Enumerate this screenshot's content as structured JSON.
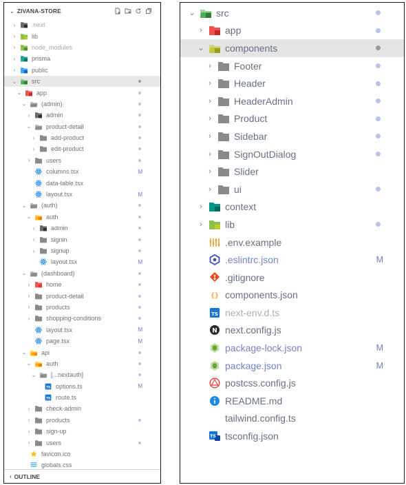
{
  "left": {
    "title": "ZIVANA-STORE",
    "outline_label": "OUTLINE",
    "rows": [
      {
        "label": ".next",
        "depth": 0,
        "chev": "right",
        "icon": "folder-next",
        "dim": true
      },
      {
        "label": "lib",
        "depth": 0,
        "chev": "right",
        "icon": "folder-lib"
      },
      {
        "label": "node_modules",
        "depth": 0,
        "chev": "right",
        "icon": "folder-node",
        "dim": true
      },
      {
        "label": "prisma",
        "depth": 0,
        "chev": "right",
        "icon": "folder-prisma"
      },
      {
        "label": "public",
        "depth": 0,
        "chev": "right",
        "icon": "folder-public"
      },
      {
        "label": "src",
        "depth": 0,
        "chev": "down",
        "icon": "folder-src",
        "dot": true,
        "selected": true
      },
      {
        "label": "app",
        "depth": 1,
        "chev": "down",
        "icon": "folder-app",
        "dot": true
      },
      {
        "label": "(admin)",
        "depth": 2,
        "chev": "down",
        "icon": "folder-gray-open",
        "dot": true
      },
      {
        "label": "admin",
        "depth": 3,
        "chev": "right",
        "icon": "folder-admin",
        "dot": true
      },
      {
        "label": "product-detail",
        "depth": 3,
        "chev": "down",
        "icon": "folder-gray-open",
        "dot": true
      },
      {
        "label": "add-product",
        "depth": 4,
        "chev": "right",
        "icon": "folder-gray",
        "dot": true
      },
      {
        "label": "edit-product",
        "depth": 4,
        "chev": "right",
        "icon": "folder-gray",
        "dot": true
      },
      {
        "label": "users",
        "depth": 3,
        "chev": "right",
        "icon": "folder-gray",
        "dot": true
      },
      {
        "label": "columns.tsx",
        "depth": 3,
        "chev": "none",
        "icon": "react",
        "status": "M"
      },
      {
        "label": "data-table.tsx",
        "depth": 3,
        "chev": "none",
        "icon": "react"
      },
      {
        "label": "layout.tsx",
        "depth": 3,
        "chev": "none",
        "icon": "react",
        "status": "M"
      },
      {
        "label": "(auth)",
        "depth": 2,
        "chev": "down",
        "icon": "folder-gray-open",
        "dot": true
      },
      {
        "label": "auth",
        "depth": 3,
        "chev": "down",
        "icon": "folder-auth",
        "dot": true
      },
      {
        "label": "admin",
        "depth": 4,
        "chev": "right",
        "icon": "folder-admin",
        "dot": true
      },
      {
        "label": "signin",
        "depth": 4,
        "chev": "right",
        "icon": "folder-gray",
        "dot": true
      },
      {
        "label": "signup",
        "depth": 4,
        "chev": "right",
        "icon": "folder-gray",
        "dot": true
      },
      {
        "label": "layout.tsx",
        "depth": 4,
        "chev": "none",
        "icon": "react",
        "status": "M"
      },
      {
        "label": "(dashboard)",
        "depth": 2,
        "chev": "down",
        "icon": "folder-gray-open",
        "dot": true
      },
      {
        "label": "home",
        "depth": 3,
        "chev": "right",
        "icon": "folder-home",
        "dot": true
      },
      {
        "label": "product-detail",
        "depth": 3,
        "chev": "right",
        "icon": "folder-gray",
        "dot": true
      },
      {
        "label": "products",
        "depth": 3,
        "chev": "right",
        "icon": "folder-gray",
        "dot": true
      },
      {
        "label": "shopping-conditions",
        "depth": 3,
        "chev": "right",
        "icon": "folder-gray",
        "dot": true
      },
      {
        "label": "layout.tsx",
        "depth": 3,
        "chev": "none",
        "icon": "react",
        "status": "M"
      },
      {
        "label": "page.tsx",
        "depth": 3,
        "chev": "none",
        "icon": "react",
        "status": "M"
      },
      {
        "label": "api",
        "depth": 2,
        "chev": "down",
        "icon": "folder-api",
        "dot": true
      },
      {
        "label": "auth",
        "depth": 3,
        "chev": "down",
        "icon": "folder-auth",
        "dot": true
      },
      {
        "label": "[...nextauth]",
        "depth": 4,
        "chev": "down",
        "icon": "folder-gray-open",
        "dot": true
      },
      {
        "label": "options.ts",
        "depth": 5,
        "chev": "none",
        "icon": "ts",
        "status": "M"
      },
      {
        "label": "route.ts",
        "depth": 5,
        "chev": "none",
        "icon": "ts"
      },
      {
        "label": "check-admin",
        "depth": 3,
        "chev": "right",
        "icon": "folder-gray"
      },
      {
        "label": "products",
        "depth": 3,
        "chev": "right",
        "icon": "folder-gray",
        "dot": true
      },
      {
        "label": "sign-up",
        "depth": 3,
        "chev": "right",
        "icon": "folder-gray"
      },
      {
        "label": "users",
        "depth": 3,
        "chev": "right",
        "icon": "folder-gray",
        "dot": true
      },
      {
        "label": "favicon.ico",
        "depth": 2,
        "chev": "none",
        "icon": "star"
      },
      {
        "label": "globals.css",
        "depth": 2,
        "chev": "none",
        "icon": "css"
      }
    ]
  },
  "right": {
    "rows": [
      {
        "label": "src",
        "depth": 0,
        "chev": "down",
        "icon": "folder-src",
        "dot": true
      },
      {
        "label": "app",
        "depth": 1,
        "chev": "right",
        "icon": "folder-app",
        "dot": true
      },
      {
        "label": "components",
        "depth": 1,
        "chev": "down",
        "icon": "folder-components",
        "dot": true,
        "selected": true
      },
      {
        "label": "Footer",
        "depth": 2,
        "chev": "right",
        "icon": "folder-gray",
        "dot": true
      },
      {
        "label": "Header",
        "depth": 2,
        "chev": "right",
        "icon": "folder-gray",
        "dot": true
      },
      {
        "label": "HeaderAdmin",
        "depth": 2,
        "chev": "right",
        "icon": "folder-gray",
        "dot": true
      },
      {
        "label": "Product",
        "depth": 2,
        "chev": "right",
        "icon": "folder-gray",
        "dot": true
      },
      {
        "label": "Sidebar",
        "depth": 2,
        "chev": "right",
        "icon": "folder-gray",
        "dot": true
      },
      {
        "label": "SignOutDialog",
        "depth": 2,
        "chev": "right",
        "icon": "folder-gray",
        "dot": true
      },
      {
        "label": "Slider",
        "depth": 2,
        "chev": "right",
        "icon": "folder-gray"
      },
      {
        "label": "ui",
        "depth": 2,
        "chev": "right",
        "icon": "folder-gray",
        "dot": true
      },
      {
        "label": "context",
        "depth": 1,
        "chev": "right",
        "icon": "folder-context"
      },
      {
        "label": "lib",
        "depth": 1,
        "chev": "right",
        "icon": "folder-lib",
        "dot": true
      },
      {
        "label": ".env.example",
        "depth": 1,
        "chev": "none",
        "icon": "env"
      },
      {
        "label": ".eslintrc.json",
        "depth": 1,
        "chev": "none",
        "icon": "eslint",
        "status": "M",
        "git": true
      },
      {
        "label": ".gitignore",
        "depth": 1,
        "chev": "none",
        "icon": "git"
      },
      {
        "label": "components.json",
        "depth": 1,
        "chev": "none",
        "icon": "json"
      },
      {
        "label": "next-env.d.ts",
        "depth": 1,
        "chev": "none",
        "icon": "ts",
        "dim": true
      },
      {
        "label": "next.config.js",
        "depth": 1,
        "chev": "none",
        "icon": "next"
      },
      {
        "label": "package-lock.json",
        "depth": 1,
        "chev": "none",
        "icon": "npm",
        "status": "M",
        "git": true
      },
      {
        "label": "package.json",
        "depth": 1,
        "chev": "none",
        "icon": "npm",
        "status": "M",
        "git": true
      },
      {
        "label": "postcss.config.js",
        "depth": 1,
        "chev": "none",
        "icon": "postcss"
      },
      {
        "label": "README.md",
        "depth": 1,
        "chev": "none",
        "icon": "info"
      },
      {
        "label": "tailwind.config.ts",
        "depth": 1,
        "chev": "none",
        "icon": "tailwind"
      },
      {
        "label": "tsconfig.json",
        "depth": 1,
        "chev": "none",
        "icon": "tsconfig"
      }
    ]
  },
  "colors": {
    "modified": "#6d7fc4",
    "dot": "#b6c3ea",
    "text": "#667085",
    "selected_bg": "#e5e5e5"
  }
}
